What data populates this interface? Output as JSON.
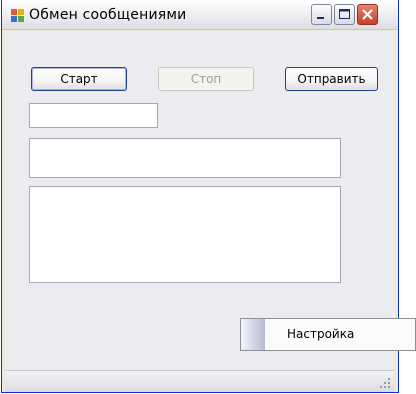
{
  "window": {
    "title": "Обмен сообщениями"
  },
  "toolbar": {
    "start_label": "Старт",
    "stop_label": "Стоп",
    "send_label": "Отправить"
  },
  "fields": {
    "small_value": "",
    "line_value": "",
    "area_value": ""
  },
  "context_menu": {
    "items": [
      {
        "label": "Настройка"
      }
    ]
  },
  "icons": {
    "app": "app-window-icon",
    "minimize": "minimize-icon",
    "maximize": "maximize-icon",
    "close": "close-icon",
    "grip": "resize-grip-icon"
  },
  "colors": {
    "close_button": "#c4422a",
    "border": "#0831d9",
    "client_bg": "#ebebf0"
  }
}
